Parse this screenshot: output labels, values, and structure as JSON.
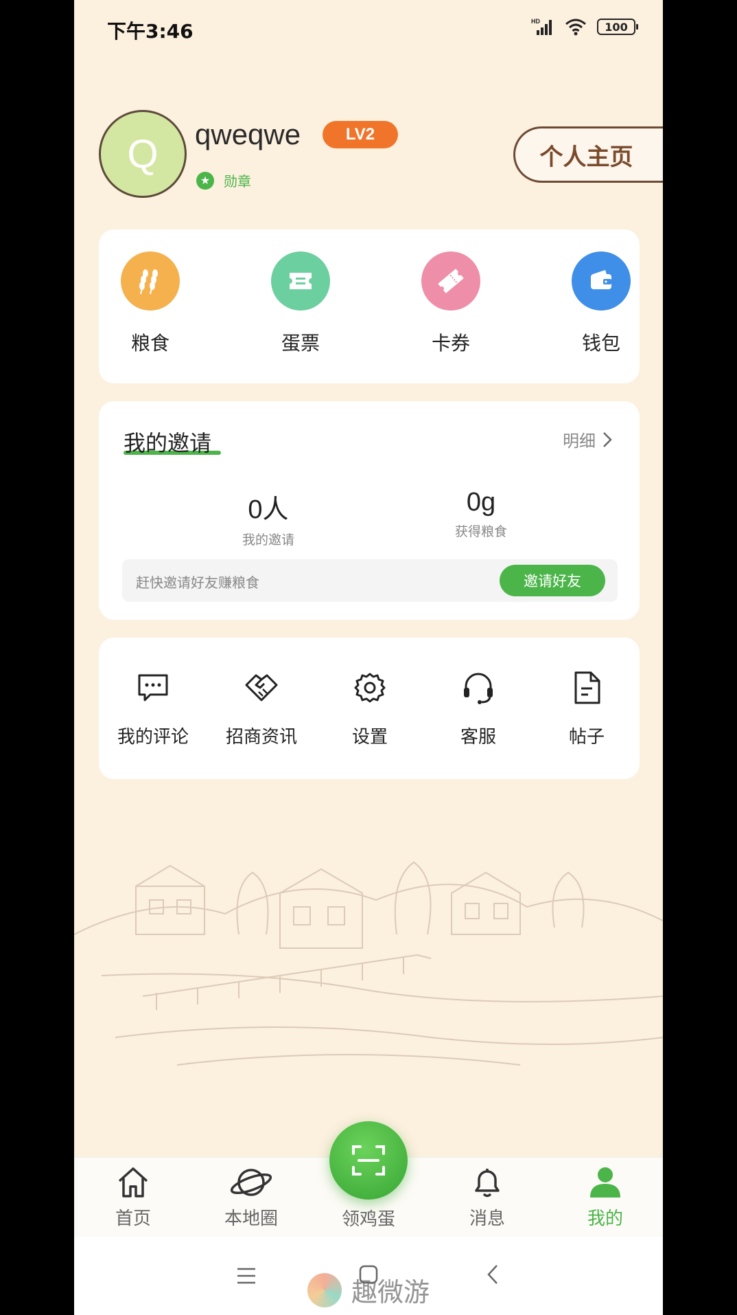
{
  "status_bar": {
    "time": "下午3:46",
    "battery": "100",
    "network": "HD"
  },
  "profile": {
    "avatar_letter": "Q",
    "username": "qweqwe",
    "level": "LV2",
    "medal_label": "勋章",
    "homepage_button": "个人主页"
  },
  "quick_actions": [
    {
      "label": "粮食",
      "icon": "wheat-icon",
      "color": "#f5b14e"
    },
    {
      "label": "蛋票",
      "icon": "ticket-icon",
      "color": "#6ccf9f"
    },
    {
      "label": "卡券",
      "icon": "coupon-icon",
      "color": "#ef8ea8"
    },
    {
      "label": "钱包",
      "icon": "wallet-icon",
      "color": "#3f8ee8"
    }
  ],
  "invite": {
    "title": "我的邀请",
    "detail_link": "明细",
    "people_count": "0人",
    "people_label": "我的邀请",
    "grain_amount": "0g",
    "grain_label": "获得粮食",
    "hint": "赶快邀请好友赚粮食",
    "button": "邀请好友"
  },
  "tools": [
    {
      "label": "我的评论",
      "icon": "comment-icon"
    },
    {
      "label": "招商资讯",
      "icon": "handshake-icon"
    },
    {
      "label": "设置",
      "icon": "gear-icon"
    },
    {
      "label": "客服",
      "icon": "headset-icon"
    },
    {
      "label": "帖子",
      "icon": "document-icon"
    }
  ],
  "bottom_nav": [
    {
      "label": "首页",
      "icon": "home-icon"
    },
    {
      "label": "本地圈",
      "icon": "planet-icon"
    },
    {
      "label": "领鸡蛋",
      "icon": "scan-icon"
    },
    {
      "label": "消息",
      "icon": "bell-icon"
    },
    {
      "label": "我的",
      "icon": "user-icon",
      "active": true
    }
  ],
  "accent_color": "#4cb54a",
  "watermark": "趣微游"
}
